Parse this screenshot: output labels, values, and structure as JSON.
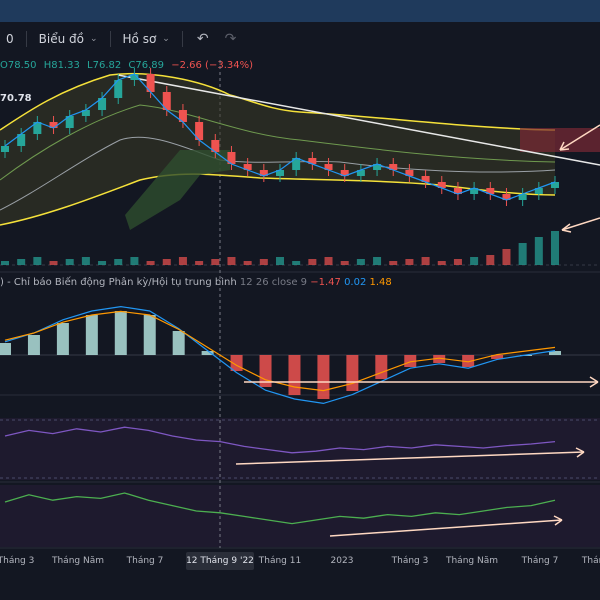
{
  "toolbar": {
    "item0_label": "0",
    "chart_type_label": "Biểu đồ",
    "profile_label": "Hồ sơ",
    "icons": [
      "chevron-down-icon",
      "undo-icon",
      "redo-icon"
    ]
  },
  "legend": {
    "open": "O78.50",
    "high": "H81.33",
    "low": "L76.82",
    "close": "C76.89",
    "change": "−2.66 (−3.34%)"
  },
  "price_tag": "70.78",
  "macd": {
    "prefix": ")",
    "title": "- Chỉ báo Biến động Phân kỳ/Hội tụ trung bình",
    "params": "12 26 close 9",
    "hist": "−1.47",
    "macd": "0.02",
    "signal": "1.48"
  },
  "xaxis": {
    "labels": [
      "Tháng 3",
      "Tháng Năm",
      "Tháng 7",
      "Tháng 11",
      "2023",
      "Tháng 3",
      "Tháng Năm",
      "Tháng 7",
      "Tháng"
    ],
    "selected": "12 Tháng 9 '22"
  },
  "colors": {
    "up": "#26a69a",
    "down": "#ef5350",
    "band": "#f5e13a",
    "ma_fast": "#2196f3",
    "ma_slow": "#ff9800",
    "rsi": "#7e57c2",
    "osc": "#4caf50",
    "arrow": "#ffd8c2"
  },
  "chart_data": {
    "type": "candlestick",
    "x": [
      "Tháng 3",
      "Tháng Năm",
      "Tháng 7",
      "Tháng 11",
      "2023",
      "Tháng 3",
      "Tháng Năm",
      "Tháng 7"
    ],
    "series": [
      {
        "values": [
          88,
          92,
          96,
          94,
          98,
          100,
          104,
          110,
          112,
          106,
          100,
          96,
          90,
          86,
          82,
          80,
          78,
          80,
          84,
          82,
          80,
          78,
          80,
          82,
          80,
          78,
          76,
          74,
          72,
          74,
          72,
          70,
          72,
          74,
          76
        ]
      },
      {
        "values": [
          0.6,
          1.0,
          1.6,
          2.0,
          2.2,
          2.0,
          1.2,
          0.2,
          -0.8,
          -1.6,
          -2.0,
          -2.2,
          -1.8,
          -1.2,
          -0.6,
          -0.4,
          -0.6,
          -0.2,
          0.0,
          0.2
        ]
      },
      {
        "values": [
          55,
          62,
          58,
          64,
          60,
          66,
          62,
          55,
          50,
          48,
          42,
          38,
          34,
          36,
          40,
          38,
          42,
          40,
          44,
          42,
          40,
          43,
          45,
          48
        ]
      },
      {
        "values": [
          50,
          58,
          52,
          56,
          54,
          60,
          52,
          46,
          40,
          38,
          34,
          30,
          26,
          30,
          34,
          32,
          36,
          34,
          38,
          36,
          40,
          44,
          46,
          52
        ]
      }
    ]
  }
}
